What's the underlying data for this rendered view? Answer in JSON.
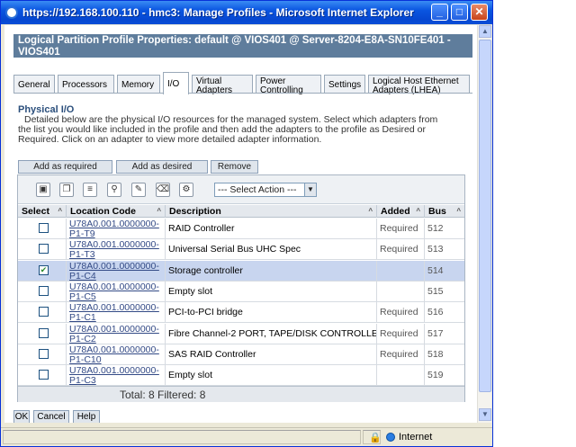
{
  "window": {
    "title": "https://192.168.100.110 - hmc3: Manage Profiles - Microsoft Internet Explorer",
    "controls": {
      "minimize": "_",
      "maximize": "□",
      "close": "✕"
    }
  },
  "header": {
    "title": "Logical Partition Profile Properties: default @ VIOS401 @ Server-8204-E8A-SN10FE401 - VIOS401"
  },
  "tabs": [
    {
      "label": "General"
    },
    {
      "label": "Processors"
    },
    {
      "label": "Memory"
    },
    {
      "label": "I/O"
    },
    {
      "label": "Virtual Adapters"
    },
    {
      "label": "Power Controlling"
    },
    {
      "label": "Settings"
    },
    {
      "label": "Logical Host Ethernet Adapters (LHEA)"
    }
  ],
  "active_tab": "I/O",
  "section": {
    "title": "Physical I/O",
    "description": "Detailed below are the physical I/O resources for the managed system. Select which adapters from the list you would like included in the profile and then add the adapters to the profile as Desired or Required. Click on an adapter to view more detailed adapter information."
  },
  "actions": {
    "add_required": "Add as required",
    "add_desired": "Add as desired",
    "remove": "Remove"
  },
  "toolbar": {
    "select_action": "--- Select Action ---"
  },
  "table": {
    "columns": [
      "Select",
      "Location Code",
      "Description",
      "Added",
      "Bus"
    ],
    "rows": [
      {
        "selected": false,
        "loc1": "U78A0.001.0000000-",
        "loc2": "P1-T9",
        "description": "RAID Controller",
        "added": "Required",
        "bus": "512"
      },
      {
        "selected": false,
        "loc1": "U78A0.001.0000000-",
        "loc2": "P1-T3",
        "description": "Universal Serial Bus UHC Spec",
        "added": "Required",
        "bus": "513"
      },
      {
        "selected": true,
        "loc1": "U78A0.001.0000000-",
        "loc2": "P1-C4",
        "description": "Storage controller",
        "added": "",
        "bus": "514"
      },
      {
        "selected": false,
        "loc1": "U78A0.001.0000000-",
        "loc2": "P1-C5",
        "description": "Empty slot",
        "added": "",
        "bus": "515"
      },
      {
        "selected": false,
        "loc1": "U78A0.001.0000000-",
        "loc2": "P1-C1",
        "description": "PCI-to-PCI bridge",
        "added": "Required",
        "bus": "516"
      },
      {
        "selected": false,
        "loc1": "U78A0.001.0000000-",
        "loc2": "P1-C2",
        "description": "Fibre Channel-2 PORT, TAPE/DISK CONTROLLER",
        "added": "Required",
        "bus": "517"
      },
      {
        "selected": false,
        "loc1": "U78A0.001.0000000-",
        "loc2": "P1-C10",
        "description": "SAS RAID Controller",
        "added": "Required",
        "bus": "518"
      },
      {
        "selected": false,
        "loc1": "U78A0.001.0000000-",
        "loc2": "P1-C3",
        "description": "Empty slot",
        "added": "",
        "bus": "519"
      }
    ],
    "footer": "Total: 8    Filtered: 8"
  },
  "buttons": {
    "ok": "OK",
    "cancel": "Cancel",
    "help": "Help"
  },
  "statusbar": {
    "zone": "Internet"
  },
  "colors": {
    "header_bg": "#5f7d9c",
    "selected_row": "#c8d5ef",
    "titlebar": "#0a55e0"
  }
}
